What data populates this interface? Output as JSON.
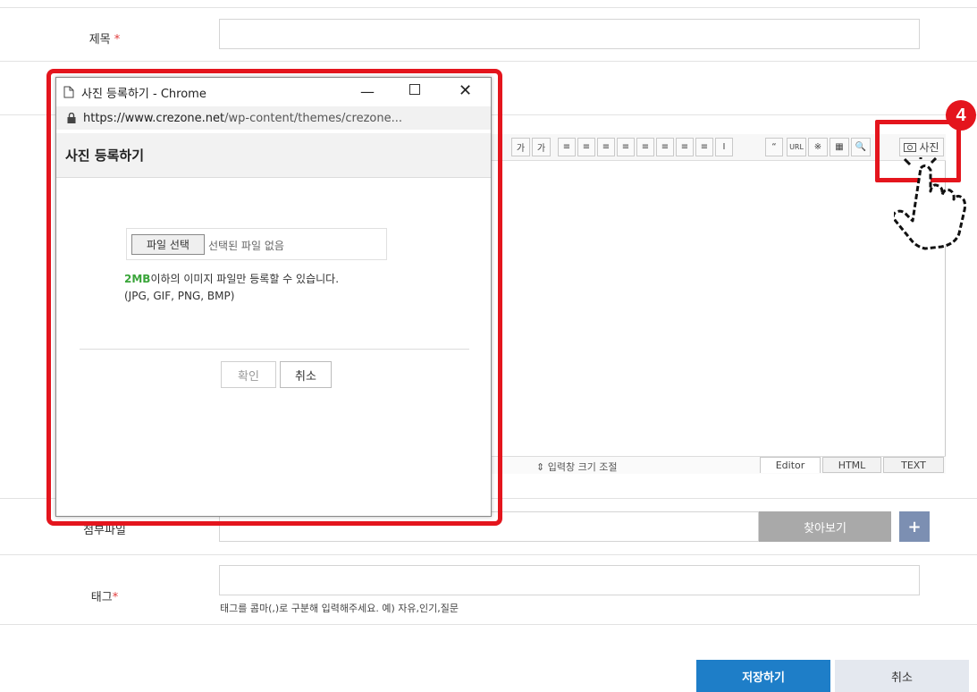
{
  "form": {
    "title_label": "제목",
    "required_mark": "*",
    "attach_label": "첨부파일",
    "browse_button": "찾아보기",
    "add_button": "+",
    "tag_label": "태그",
    "tag_hint": "태그를 콤마(,)로 구분해 입력해주세요. 예) 자유,인기,질문",
    "save_button": "저장하기",
    "cancel_button": "취소"
  },
  "editor": {
    "toolbar": [
      "가",
      "가",
      "≡",
      "≡",
      "≡",
      "≡",
      "≡",
      "≡",
      "≡",
      "≡",
      "I",
      "“",
      "URL",
      "※",
      "▦",
      "🔍"
    ],
    "photo_button": "사진",
    "resize_label": "⇕ 입력창 크기 조절",
    "tabs": [
      "Editor",
      "HTML",
      "TEXT"
    ]
  },
  "step_badge": "4",
  "popup": {
    "window_title": "사진 등록하기 - Chrome",
    "url_domain": "https://www.crezone.net",
    "url_path": "/wp-content/themes/crezone...",
    "heading": "사진 등록하기",
    "file_button": "파일 선택",
    "no_file_text": "선택된 파일 없음",
    "size_highlight": "2MB",
    "size_text": "이하의 이미지 파일만 등록할 수 있습니다.",
    "formats": "(JPG, GIF, PNG, BMP)",
    "confirm_button": "확인",
    "cancel_button": "취소"
  },
  "colors": {
    "highlight": "#e4151d",
    "primary": "#1e7ec8",
    "green": "#3aa53a"
  }
}
